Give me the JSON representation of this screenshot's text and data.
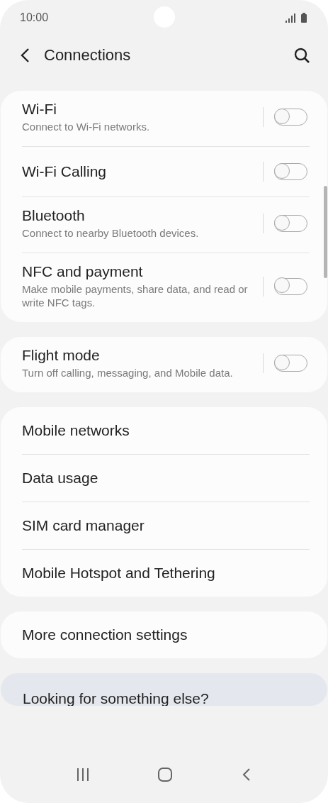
{
  "status_bar": {
    "time": "10:00"
  },
  "header": {
    "title": "Connections"
  },
  "groups": [
    {
      "items": [
        {
          "kind": "toggle",
          "title": "Wi-Fi",
          "subtitle": "Connect to Wi-Fi networks.",
          "on": false
        },
        {
          "kind": "toggle",
          "title": "Wi-Fi Calling",
          "on": false
        },
        {
          "kind": "toggle",
          "title": "Bluetooth",
          "subtitle": "Connect to nearby Bluetooth devices.",
          "on": false
        },
        {
          "kind": "toggle",
          "title": "NFC and payment",
          "subtitle": "Make mobile payments, share data, and read or write NFC tags.",
          "on": false
        }
      ]
    },
    {
      "items": [
        {
          "kind": "toggle",
          "title": "Flight mode",
          "subtitle": "Turn off calling, messaging, and Mobile data.",
          "on": false
        }
      ]
    },
    {
      "items": [
        {
          "kind": "link",
          "title": "Mobile networks"
        },
        {
          "kind": "link",
          "title": "Data usage"
        },
        {
          "kind": "link",
          "title": "SIM card manager"
        },
        {
          "kind": "link",
          "title": "Mobile Hotspot and Tethering"
        }
      ]
    },
    {
      "items": [
        {
          "kind": "link",
          "title": "More connection settings"
        }
      ]
    }
  ],
  "suggestion": {
    "title": "Looking for something else?"
  }
}
